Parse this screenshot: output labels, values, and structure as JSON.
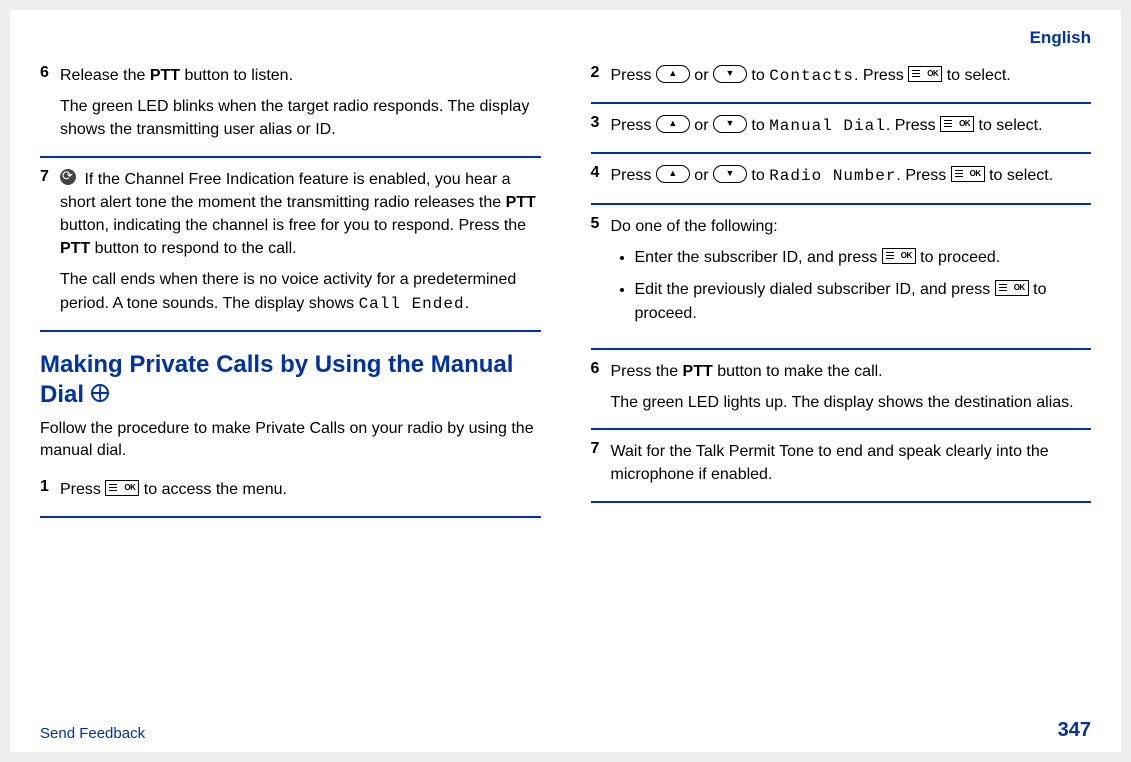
{
  "language": "English",
  "left": {
    "step6": {
      "num": "6",
      "p1a": "Release the ",
      "p1b": "PTT",
      "p1c": " button to listen.",
      "p2": "The green LED blinks when the target radio responds. The display shows the transmitting user alias or ID."
    },
    "step7": {
      "num": "7",
      "p1a": " If the Channel Free Indication feature is enabled, you hear a short alert tone the moment the transmitting radio releases the ",
      "p1b": "PTT",
      "p1c": " button, indicating the channel is free for you to respond. Press the ",
      "p1d": "PTT",
      "p1e": " button to respond to the call.",
      "p2a": "The call ends when there is no voice activity for a predetermined period. A tone sounds. The display shows ",
      "p2b": "Call Ended",
      "p2c": "."
    },
    "heading": "Making Private Calls by Using the Manual Dial ",
    "intro": "Follow the procedure to make Private Calls on your radio by using the manual dial.",
    "step1": {
      "num": "1",
      "p1a": "Press ",
      "p1b": " to access the menu."
    }
  },
  "right": {
    "step2": {
      "num": "2",
      "a": "Press ",
      "b": " or ",
      "c": " to ",
      "target": "Contacts",
      "d": ". Press ",
      "e": " to select."
    },
    "step3": {
      "num": "3",
      "a": "Press ",
      "b": " or ",
      "c": " to ",
      "target": "Manual Dial",
      "d": ". Press ",
      "e": " to select."
    },
    "step4": {
      "num": "4",
      "a": "Press ",
      "b": " or ",
      "c": " to ",
      "target": "Radio Number",
      "d": ". Press ",
      "e": " to select."
    },
    "step5": {
      "num": "5",
      "lead": "Do one of the following:",
      "b1a": "Enter the subscriber ID, and press ",
      "b1b": " to proceed.",
      "b2a": "Edit the previously dialed subscriber ID, and press ",
      "b2b": " to proceed."
    },
    "step6": {
      "num": "6",
      "p1a": "Press the ",
      "p1b": "PTT",
      "p1c": " button to make the call.",
      "p2": "The green LED lights up. The display shows the destination alias."
    },
    "step7": {
      "num": "7",
      "p1": "Wait for the Talk Permit Tone to end and speak clearly into the microphone if enabled."
    }
  },
  "footer": {
    "feedback": "Send Feedback",
    "page": "347"
  }
}
